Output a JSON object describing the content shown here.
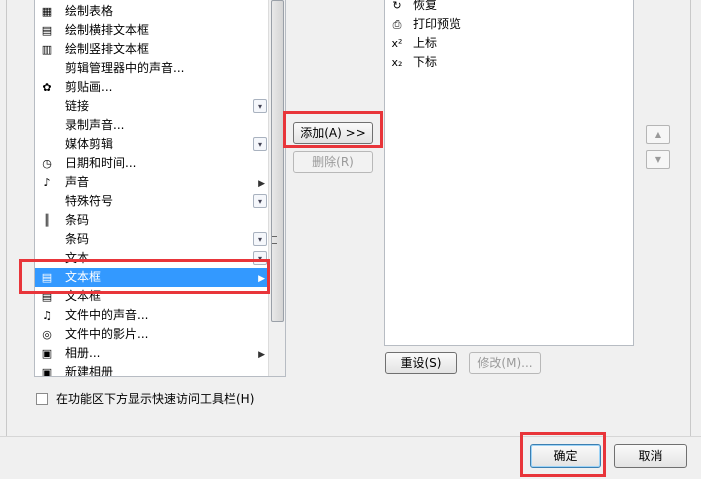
{
  "left_list": {
    "items": [
      {
        "label": "绘制表格",
        "icon": "table-grid-icon",
        "tail": ""
      },
      {
        "label": "绘制横排文本框",
        "icon": "textbox-horizontal-icon",
        "tail": ""
      },
      {
        "label": "绘制竖排文本框",
        "icon": "textbox-vertical-icon",
        "tail": ""
      },
      {
        "label": "剪辑管理器中的声音...",
        "icon": "",
        "tail": ""
      },
      {
        "label": "剪贴画...",
        "icon": "clipart-icon",
        "tail": ""
      },
      {
        "label": "链接",
        "icon": "",
        "tail": "dropdown"
      },
      {
        "label": "录制声音...",
        "icon": "",
        "tail": ""
      },
      {
        "label": "媒体剪辑",
        "icon": "",
        "tail": "dropdown"
      },
      {
        "label": "日期和时间...",
        "icon": "date-time-icon",
        "tail": ""
      },
      {
        "label": "声音",
        "icon": "sound-icon",
        "tail": "submenu"
      },
      {
        "label": "特殊符号",
        "icon": "",
        "tail": "dropdown"
      },
      {
        "label": "条码",
        "icon": "barcode-icon",
        "tail": ""
      },
      {
        "label": "条码",
        "icon": "",
        "tail": "dropdown"
      },
      {
        "label": "文本",
        "icon": "",
        "tail": "dropdown"
      },
      {
        "label": "文本框",
        "icon": "textbox-icon",
        "tail": "submenu",
        "selected": true
      },
      {
        "label": "文本框",
        "icon": "textbox-icon",
        "tail": ""
      },
      {
        "label": "文件中的声音...",
        "icon": "sound-file-icon",
        "tail": ""
      },
      {
        "label": "文件中的影片...",
        "icon": "movie-file-icon",
        "tail": ""
      },
      {
        "label": "相册...",
        "icon": "photo-album-icon",
        "tail": "submenu"
      },
      {
        "label": "新建相册",
        "icon": "new-album-icon",
        "tail": ""
      }
    ]
  },
  "buttons": {
    "add": "添加(A) >>",
    "remove": "删除(R)",
    "reset": "重设(S)",
    "modify": "修改(M)...",
    "ok": "确定",
    "cancel": "取消"
  },
  "right_list": {
    "items": [
      {
        "label": "恢复",
        "icon": "redo-icon"
      },
      {
        "label": "打印预览",
        "icon": "print-preview-icon"
      },
      {
        "label": "上标",
        "icon": "superscript-icon"
      },
      {
        "label": "下标",
        "icon": "subscript-icon"
      }
    ]
  },
  "checkbox": {
    "label": "在功能区下方显示快速访问工具栏(H)",
    "checked": false
  },
  "colors": {
    "highlight": "#e8353a",
    "selection": "#3399ff"
  }
}
